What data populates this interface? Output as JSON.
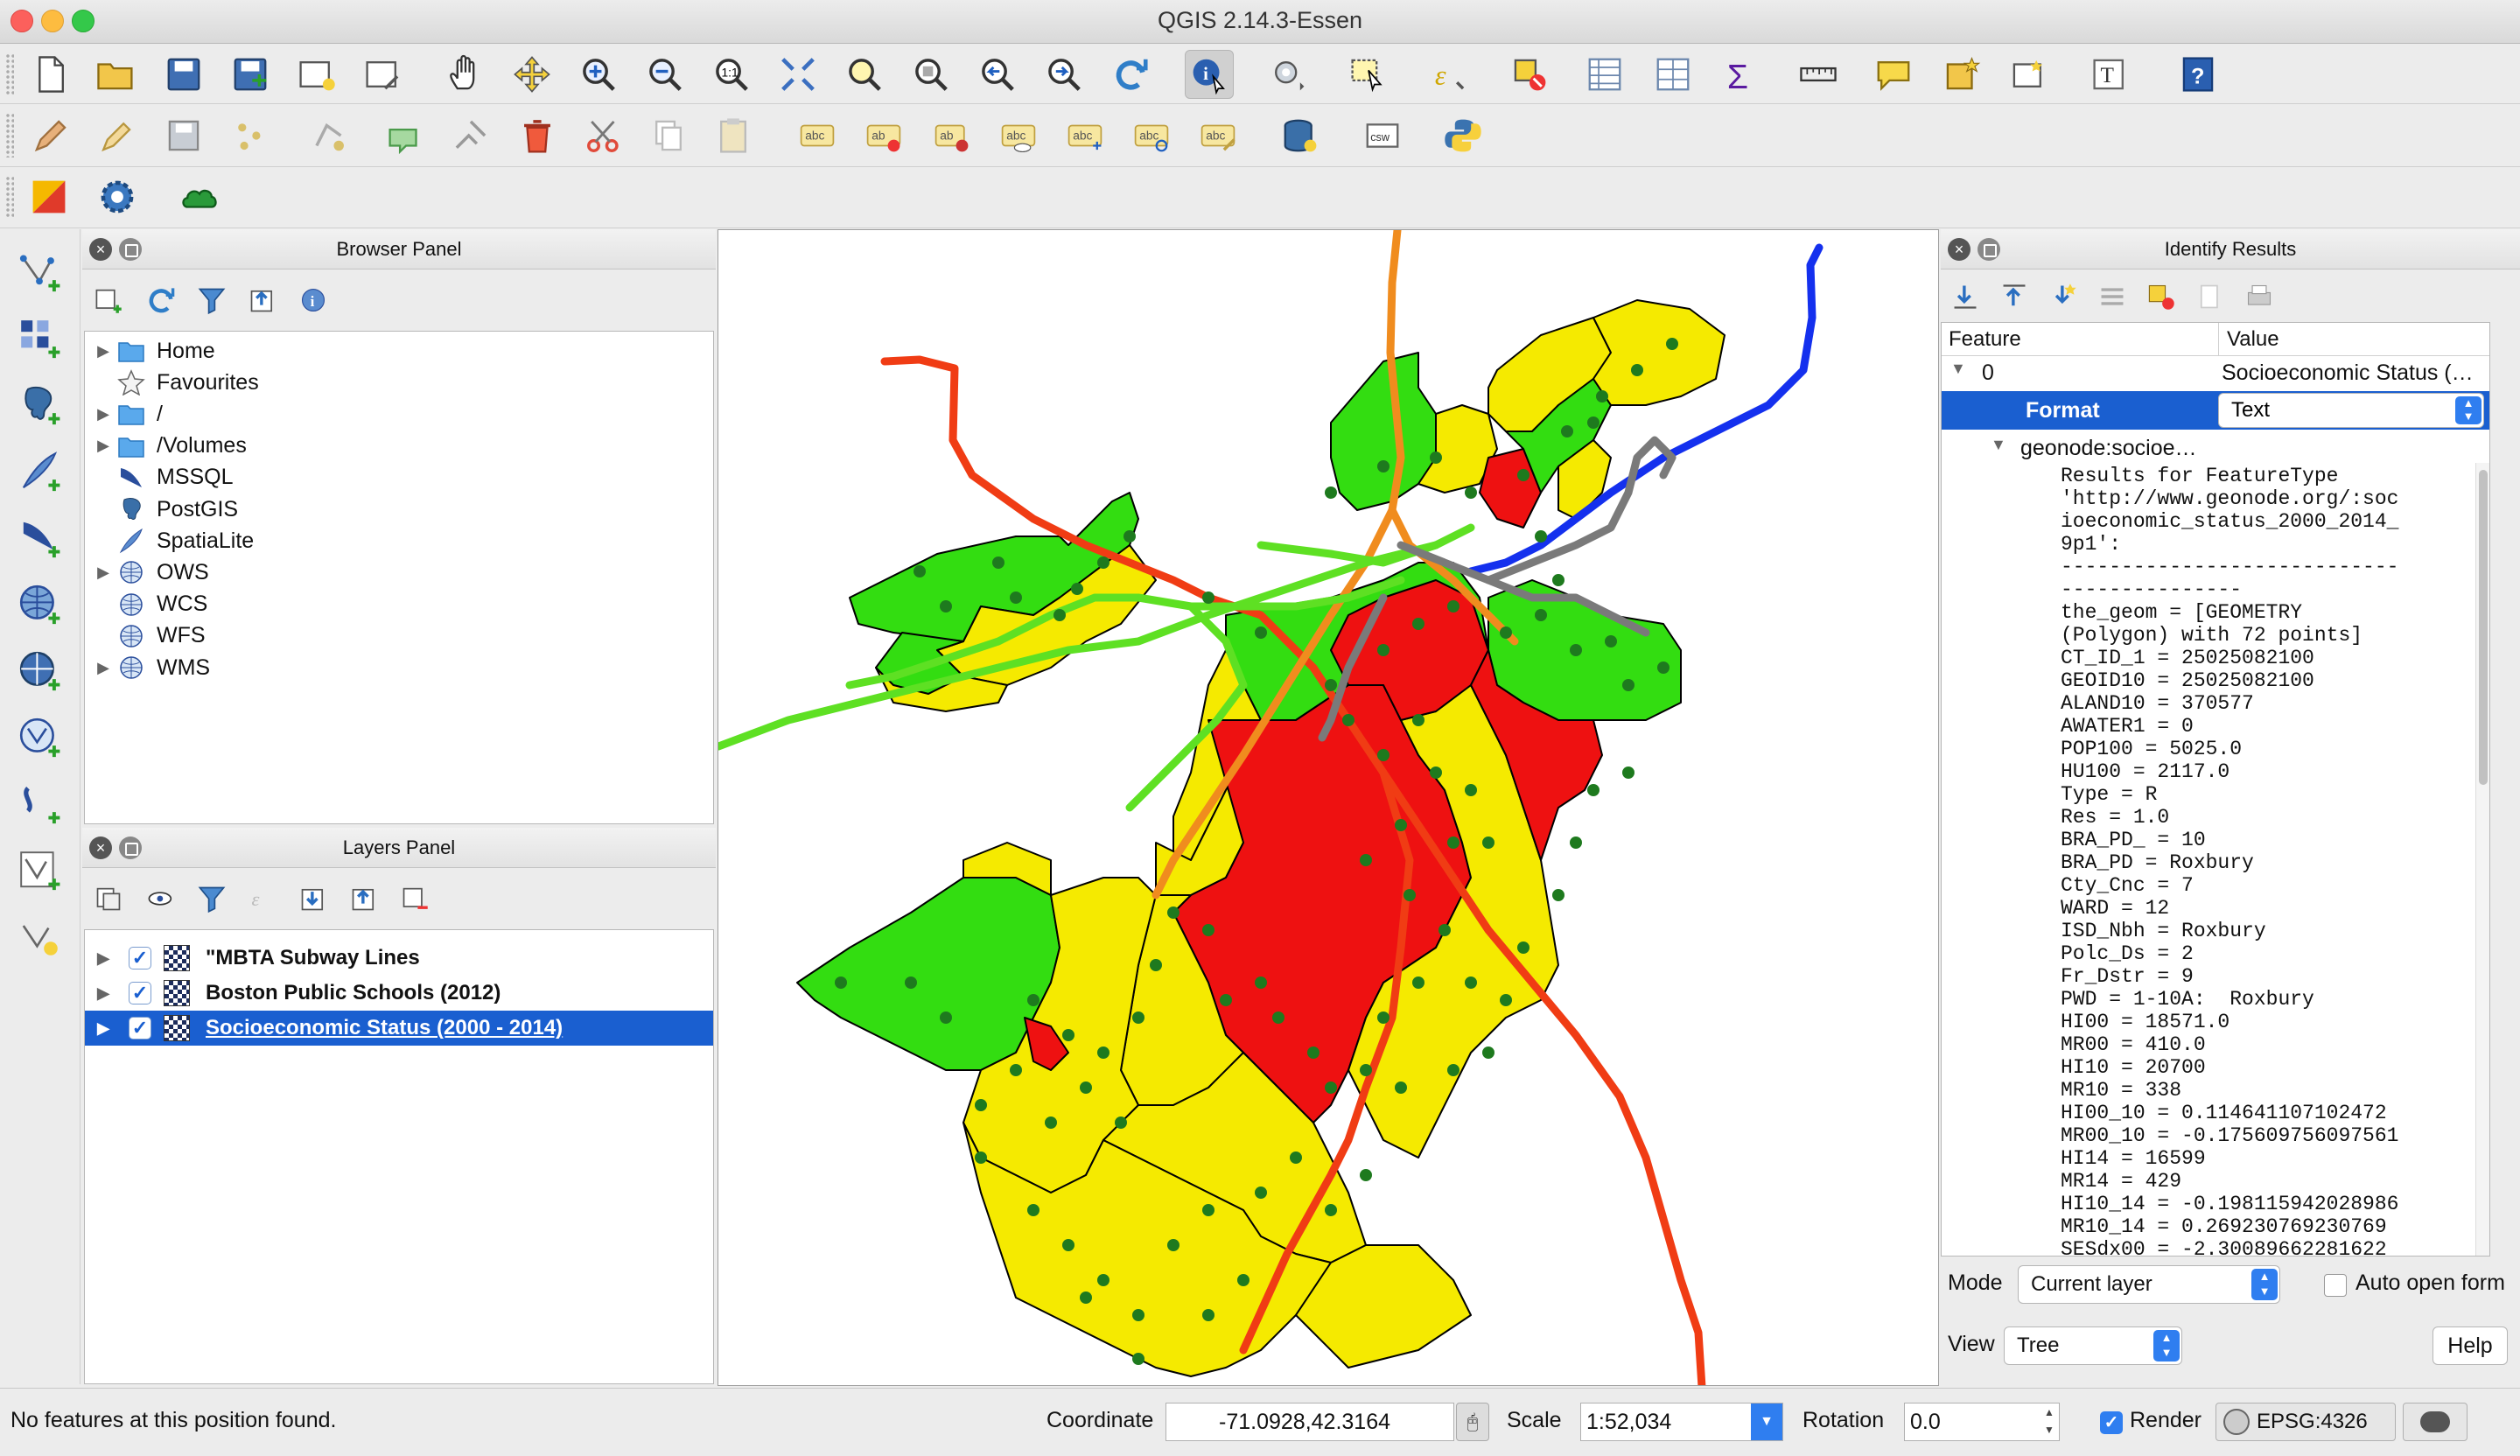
{
  "window": {
    "title": "QGIS 2.14.3-Essen"
  },
  "toolbar": {
    "main_icons": [
      "new-project-icon",
      "open-project-icon",
      "save-project-icon",
      "save-as-icon",
      "new-print-composer-icon",
      "composer-manager-icon",
      "pan-icon",
      "pan-to-selection-icon",
      "zoom-in-icon",
      "zoom-out-icon",
      "zoom-actual-icon",
      "zoom-full-icon",
      "zoom-to-selection-icon",
      "zoom-to-layer-icon",
      "zoom-last-icon",
      "zoom-next-icon",
      "refresh-icon",
      "identify-icon",
      "run-action-icon",
      "select-icon",
      "select-expression-icon",
      "deselect-icon",
      "attribute-table-icon",
      "field-calculator-icon",
      "statistics-icon",
      "measure-icon",
      "map-tips-icon",
      "new-bookmark-icon",
      "show-bookmarks-icon",
      "text-annotation-icon",
      "help-icon"
    ],
    "csw_label": "csw"
  },
  "browser": {
    "title": "Browser Panel",
    "items": [
      {
        "label": "Home",
        "icon": "folder-icon",
        "expandable": true
      },
      {
        "label": "Favourites",
        "icon": "star-icon",
        "expandable": false
      },
      {
        "label": "/",
        "icon": "folder-icon",
        "expandable": true
      },
      {
        "label": "/Volumes",
        "icon": "folder-icon",
        "expandable": true
      },
      {
        "label": "MSSQL",
        "icon": "mssql-icon",
        "expandable": false
      },
      {
        "label": "PostGIS",
        "icon": "postgis-icon",
        "expandable": false
      },
      {
        "label": "SpatiaLite",
        "icon": "spatialite-icon",
        "expandable": false
      },
      {
        "label": "OWS",
        "icon": "globe-icon",
        "expandable": true
      },
      {
        "label": "WCS",
        "icon": "globe-icon",
        "expandable": false
      },
      {
        "label": "WFS",
        "icon": "globe-icon",
        "expandable": false
      },
      {
        "label": "WMS",
        "icon": "globe-icon",
        "expandable": true
      }
    ]
  },
  "layers": {
    "title": "Layers Panel",
    "items": [
      {
        "label": "\"MBTA Subway Lines",
        "checked": true,
        "selected": false
      },
      {
        "label": "Boston Public Schools (2012)",
        "checked": true,
        "selected": false
      },
      {
        "label": "Socioeconomic Status (2000 - 2014)",
        "checked": true,
        "selected": true
      }
    ]
  },
  "identify": {
    "title": "Identify Results",
    "col_feature": "Feature",
    "col_value": "Value",
    "row0_feature": "0",
    "row0_value": "Socioeconomic Status (…",
    "format_label": "Format",
    "format_value": "Text",
    "child_label": "geonode:socioe…",
    "result_text": "Results for FeatureType\n'http://www.geonode.org/:soc\nioeconomic_status_2000_2014_\n9p1':\n----------------------------\n---------------\nthe_geom = [GEOMETRY\n(Polygon) with 72 points]\nCT_ID_1 = 25025082100\nGEOID10 = 25025082100\nALAND10 = 370577\nAWATER1 = 0\nPOP100 = 5025.0\nHU100 = 2117.0\nType = R\nRes = 1.0\nBRA_PD_ = 10\nBRA_PD = Roxbury\nCty_Cnc = 7\nWARD = 12\nISD_Nbh = Roxbury\nPolc_Ds = 2\nFr_Dstr = 9\nPWD = 1-10A:  Roxbury\nHI00 = 18571.0\nMR00 = 410.0\nHI10 = 20700\nMR10 = 338\nHI00_10 = 0.114641107102472\nMR00_10 = -0.175609756097561\nHI14 = 16599\nMR14 = 429\nHI10_14 = -0.198115942028986\nMR10_14 = 0.269230769230769\nSESdx00 = -2.30089662281622",
    "mode_label": "Mode",
    "mode_value": "Current layer",
    "auto_open_label": "Auto open form",
    "view_label": "View",
    "view_value": "Tree",
    "help_label": "Help"
  },
  "status": {
    "message": "No features at this position found.",
    "coordinate_label": "Coordinate",
    "coordinate_value": "-71.0928,42.3164",
    "scale_label": "Scale",
    "scale_value": "1:52,034",
    "rotation_label": "Rotation",
    "rotation_value": "0.0",
    "render_label": "Render",
    "crs": "EPSG:4326"
  },
  "map_colors": {
    "high": "#33dd11",
    "mid": "#f5ea00",
    "low": "#ee1111",
    "school": "#1e7a1e",
    "red_line": "#f03c14",
    "orange_line": "#f08c1e",
    "green_line": "#5ee023",
    "blue_line": "#1430ee",
    "silver_line": "#7a7a7a"
  }
}
